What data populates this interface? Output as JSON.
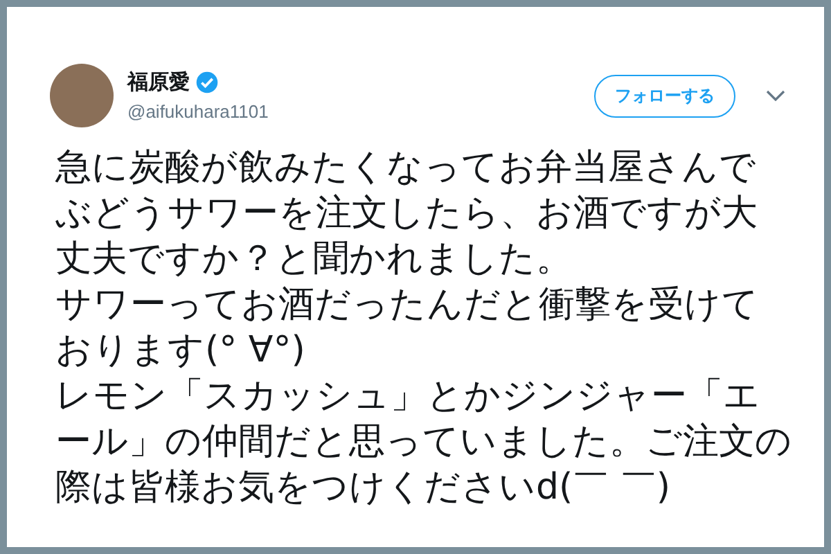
{
  "author": {
    "name": "福原愛",
    "verified": true,
    "handle": "@aifukuhara1101"
  },
  "follow_button": {
    "label": "フォローする"
  },
  "paragraphs": [
    "急に炭酸が飲みたくなってお弁当屋さんでぶどうサワーを注文したら、お酒ですが大丈夫ですか？と聞かれました。",
    "サワーってお酒だったんだと衝撃を受けております(° ∀°)",
    "レモン「スカッシュ」とかジンジャー「エール」の仲間だと思っていました。ご注文の際は皆様お気をつけくださいd(￣ ￣)"
  ]
}
